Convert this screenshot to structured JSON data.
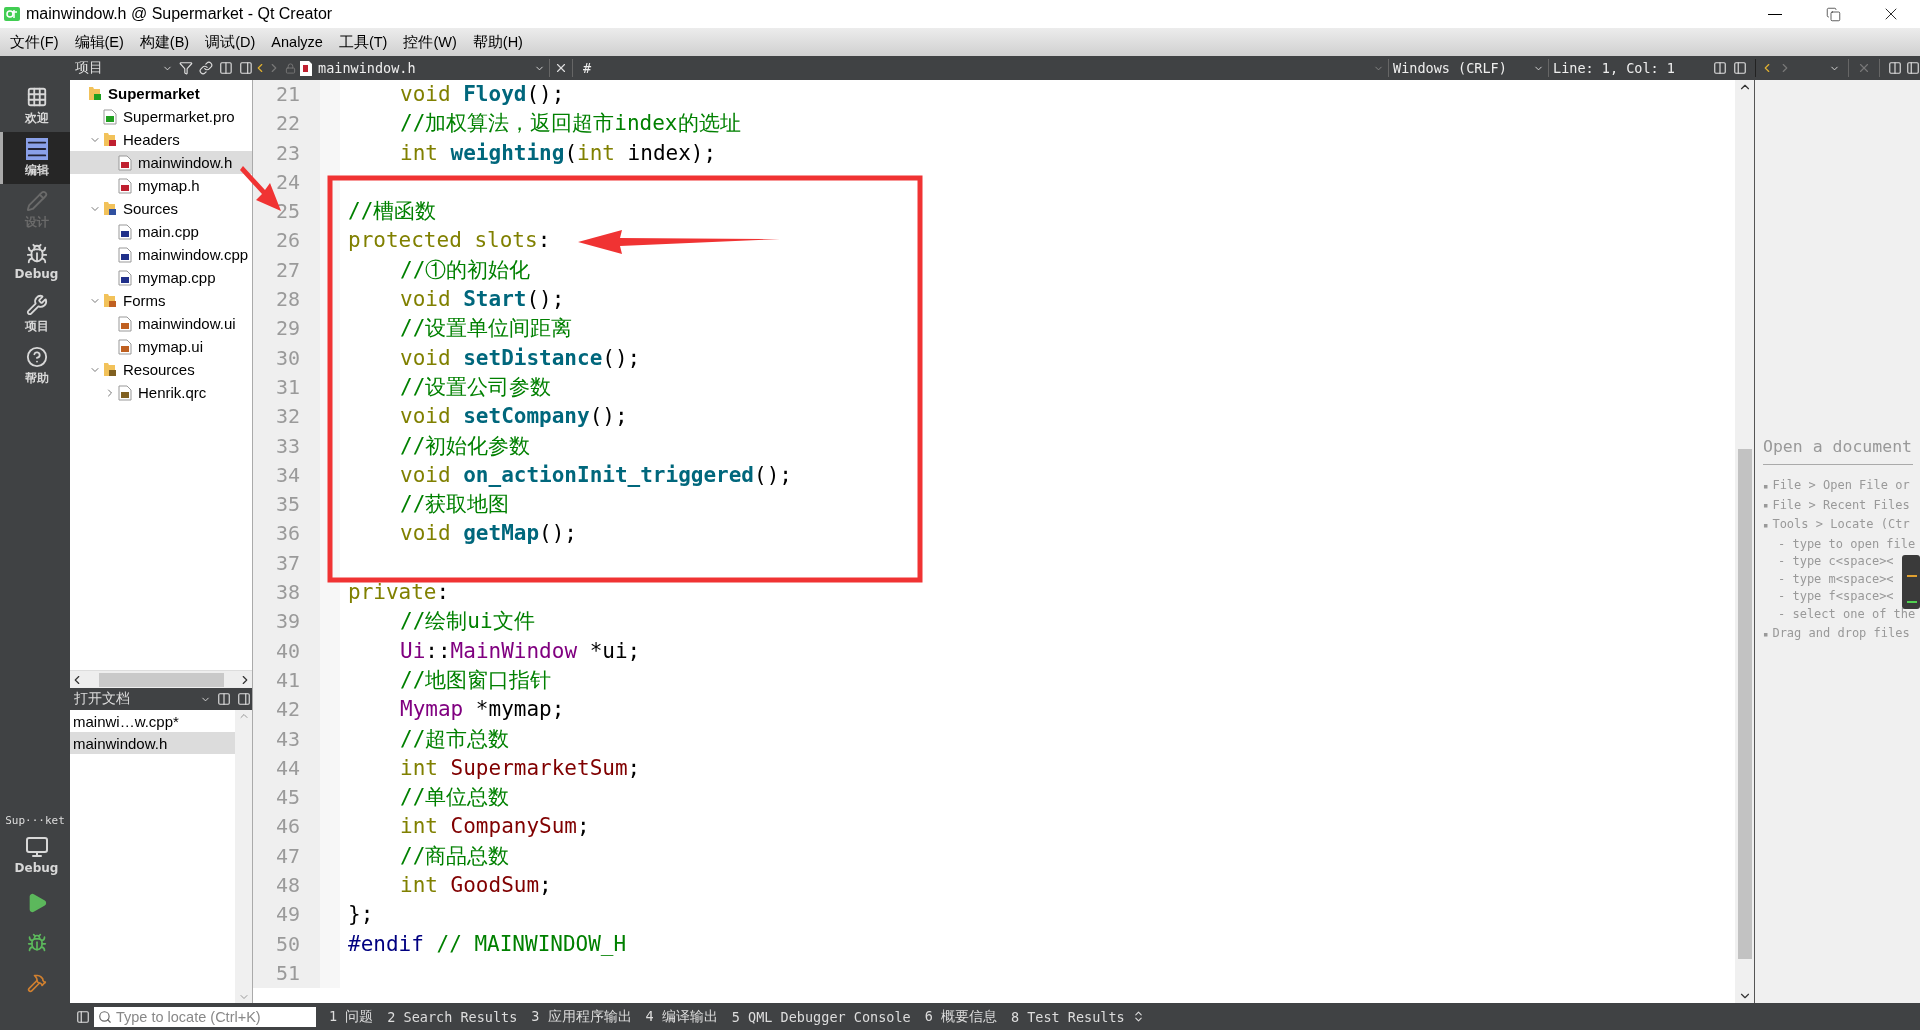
{
  "window": {
    "title": "mainwindow.h @ Supermarket - Qt Creator"
  },
  "menu": [
    "文件(F)",
    "编辑(E)",
    "构建(B)",
    "调试(D)",
    "Analyze",
    "工具(T)",
    "控件(W)",
    "帮助(H)"
  ],
  "mode_bar": {
    "items": [
      {
        "label": "欢迎",
        "kind": "welcome",
        "selected": false,
        "disabled": false
      },
      {
        "label": "编辑",
        "kind": "edit",
        "selected": true,
        "disabled": false
      },
      {
        "label": "设计",
        "kind": "design",
        "selected": false,
        "disabled": true
      },
      {
        "label": "Debug",
        "kind": "debug",
        "selected": false,
        "disabled": false
      },
      {
        "label": "项目",
        "kind": "projects",
        "selected": false,
        "disabled": false
      },
      {
        "label": "帮助",
        "kind": "help",
        "selected": false,
        "disabled": false
      }
    ],
    "kit": {
      "project": "Sup···ket",
      "build": "Debug"
    }
  },
  "project_pane": {
    "selector": "项目",
    "tree": [
      {
        "label": "Supermarket",
        "kind": "project",
        "selected": false,
        "children": [
          {
            "label": "Supermarket.pro",
            "kind": "pro",
            "selected": false
          },
          {
            "label": "Headers",
            "kind": "folder-h",
            "expanded": true,
            "selected": false,
            "children": [
              {
                "label": "mainwindow.h",
                "kind": "file-h",
                "selected": true
              },
              {
                "label": "mymap.h",
                "kind": "file-h",
                "selected": false
              }
            ]
          },
          {
            "label": "Sources",
            "kind": "folder-cpp",
            "expanded": true,
            "selected": false,
            "children": [
              {
                "label": "main.cpp",
                "kind": "file-cpp",
                "selected": false
              },
              {
                "label": "mainwindow.cpp",
                "kind": "file-cpp",
                "selected": false
              },
              {
                "label": "mymap.cpp",
                "kind": "file-cpp",
                "selected": false
              }
            ]
          },
          {
            "label": "Forms",
            "kind": "folder-ui",
            "expanded": true,
            "selected": false,
            "children": [
              {
                "label": "mainwindow.ui",
                "kind": "file-ui",
                "selected": false
              },
              {
                "label": "mymap.ui",
                "kind": "file-ui",
                "selected": false
              }
            ]
          },
          {
            "label": "Resources",
            "kind": "folder-qrc",
            "expanded": true,
            "selected": false,
            "children": [
              {
                "label": "Henrik.qrc",
                "kind": "file-qrc",
                "expanded": false,
                "selected": false
              }
            ]
          }
        ]
      }
    ]
  },
  "open_documents": {
    "title": "打开文档",
    "items": [
      {
        "label": "mainwi…w.cpp*",
        "selected": false
      },
      {
        "label": "mainwindow.h",
        "selected": true
      }
    ]
  },
  "editor": {
    "file": "mainwindow.h",
    "marker": "#",
    "line_endings": "Windows (CRLF)",
    "position": "Line: 1, Col: 1",
    "lines": [
      {
        "number": "21",
        "indented": true,
        "tokens": [
          {
            "kind": "keyword",
            "text": "void "
          },
          {
            "kind": "function",
            "text": "Floyd"
          },
          {
            "kind": "plain",
            "text": "();"
          }
        ]
      },
      {
        "number": "22",
        "indented": true,
        "tokens": [
          {
            "kind": "comment",
            "text": "//加权算法，返回超市index的选址"
          }
        ]
      },
      {
        "number": "23",
        "indented": true,
        "tokens": [
          {
            "kind": "keyword",
            "text": "int "
          },
          {
            "kind": "function",
            "text": "weighting"
          },
          {
            "kind": "plain",
            "text": "("
          },
          {
            "kind": "keyword",
            "text": "int"
          },
          {
            "kind": "plain",
            "text": " index);"
          }
        ]
      },
      {
        "number": "24"
      },
      {
        "number": "25",
        "indented": false,
        "tokens": [
          {
            "kind": "comment",
            "text": "//槽函数"
          }
        ]
      },
      {
        "number": "26",
        "indented": false,
        "tokens": [
          {
            "kind": "keyword",
            "text": "protected slots"
          },
          {
            "kind": "plain",
            "text": ":"
          }
        ]
      },
      {
        "number": "27",
        "indented": true,
        "tokens": [
          {
            "kind": "comment",
            "text": "//①的初始化"
          }
        ]
      },
      {
        "number": "28",
        "indented": true,
        "tokens": [
          {
            "kind": "keyword",
            "text": "void "
          },
          {
            "kind": "function",
            "text": "Start"
          },
          {
            "kind": "plain",
            "text": "();"
          }
        ]
      },
      {
        "number": "29",
        "indented": true,
        "tokens": [
          {
            "kind": "comment",
            "text": "//设置单位间距离"
          }
        ]
      },
      {
        "number": "30",
        "indented": true,
        "tokens": [
          {
            "kind": "keyword",
            "text": "void "
          },
          {
            "kind": "function",
            "text": "setDistance"
          },
          {
            "kind": "plain",
            "text": "();"
          }
        ]
      },
      {
        "number": "31",
        "indented": true,
        "tokens": [
          {
            "kind": "comment",
            "text": "//设置公司参数"
          }
        ]
      },
      {
        "number": "32",
        "indented": true,
        "tokens": [
          {
            "kind": "keyword",
            "text": "void "
          },
          {
            "kind": "function",
            "text": "setCompany"
          },
          {
            "kind": "plain",
            "text": "();"
          }
        ]
      },
      {
        "number": "33",
        "indented": true,
        "tokens": [
          {
            "kind": "comment",
            "text": "//初始化参数"
          }
        ]
      },
      {
        "number": "34",
        "indented": true,
        "tokens": [
          {
            "kind": "keyword",
            "text": "void "
          },
          {
            "kind": "function",
            "text": "on_actionInit_triggered"
          },
          {
            "kind": "plain",
            "text": "();"
          }
        ]
      },
      {
        "number": "35",
        "indented": true,
        "tokens": [
          {
            "kind": "comment",
            "text": "//获取地图"
          }
        ]
      },
      {
        "number": "36",
        "indented": true,
        "tokens": [
          {
            "kind": "keyword",
            "text": "void "
          },
          {
            "kind": "function",
            "text": "getMap"
          },
          {
            "kind": "plain",
            "text": "();"
          }
        ]
      },
      {
        "number": "37"
      },
      {
        "number": "38",
        "indented": false,
        "tokens": [
          {
            "kind": "keyword",
            "text": "private"
          },
          {
            "kind": "plain",
            "text": ":"
          }
        ]
      },
      {
        "number": "39",
        "indented": true,
        "tokens": [
          {
            "kind": "comment",
            "text": "//绘制ui文件"
          }
        ]
      },
      {
        "number": "40",
        "indented": true,
        "tokens": [
          {
            "kind": "type",
            "text": "Ui"
          },
          {
            "kind": "plain",
            "text": "::"
          },
          {
            "kind": "type",
            "text": "MainWindow"
          },
          {
            "kind": "plain",
            "text": " *ui;"
          }
        ]
      },
      {
        "number": "41",
        "indented": true,
        "tokens": [
          {
            "kind": "comment",
            "text": "//地图窗口指针"
          }
        ]
      },
      {
        "number": "42",
        "indented": true,
        "tokens": [
          {
            "kind": "type",
            "text": "Mymap"
          },
          {
            "kind": "plain",
            "text": " *mymap;"
          }
        ]
      },
      {
        "number": "43",
        "indented": true,
        "tokens": [
          {
            "kind": "comment",
            "text": "//超市总数"
          }
        ]
      },
      {
        "number": "44",
        "indented": true,
        "tokens": [
          {
            "kind": "keyword",
            "text": "int "
          },
          {
            "kind": "member",
            "text": "SupermarketSum"
          },
          {
            "kind": "plain",
            "text": ";"
          }
        ]
      },
      {
        "number": "45",
        "indented": true,
        "tokens": [
          {
            "kind": "comment",
            "text": "//单位总数"
          }
        ]
      },
      {
        "number": "46",
        "indented": true,
        "tokens": [
          {
            "kind": "keyword",
            "text": "int "
          },
          {
            "kind": "member",
            "text": "CompanySum"
          },
          {
            "kind": "plain",
            "text": ";"
          }
        ]
      },
      {
        "number": "47",
        "indented": true,
        "tokens": [
          {
            "kind": "comment",
            "text": "//商品总数"
          }
        ]
      },
      {
        "number": "48",
        "indented": true,
        "tokens": [
          {
            "kind": "keyword",
            "text": "int "
          },
          {
            "kind": "member",
            "text": "GoodSum"
          },
          {
            "kind": "plain",
            "text": ";"
          }
        ]
      },
      {
        "number": "49",
        "indented": false,
        "tokens": [
          {
            "kind": "plain",
            "text": "};"
          }
        ]
      },
      {
        "number": "50",
        "indented": false,
        "tokens": [
          {
            "kind": "preprocessor",
            "text": "#endif"
          },
          {
            "kind": "comment",
            "text": " // MAINWINDOW_H"
          }
        ]
      },
      {
        "number": "51"
      }
    ]
  },
  "outline_pane": {
    "title": "Open a document",
    "hints": [
      {
        "bullet": "▪",
        "text": "File > Open File or"
      },
      {
        "bullet": "▪",
        "text": "File > Recent Files"
      },
      {
        "bullet": "▪",
        "text": "Tools > Locate (Ctr",
        "children": [
          {
            "text": "- type to open file"
          },
          {
            "text": "- type c<space><"
          },
          {
            "text": "- type m<space><"
          },
          {
            "text": "- type f<space><"
          },
          {
            "text": "- select one of the"
          }
        ]
      },
      {
        "bullet": "▪",
        "text": "Drag and drop files"
      }
    ]
  },
  "bottom_bar": {
    "locate_placeholder": "Type to locate (Ctrl+K)",
    "panes": [
      "1 问题",
      "2 Search Results",
      "3 应用程序输出",
      "4 编译输出",
      "5 QML Debugger Console",
      "6 概要信息",
      "8 Test Results"
    ]
  }
}
